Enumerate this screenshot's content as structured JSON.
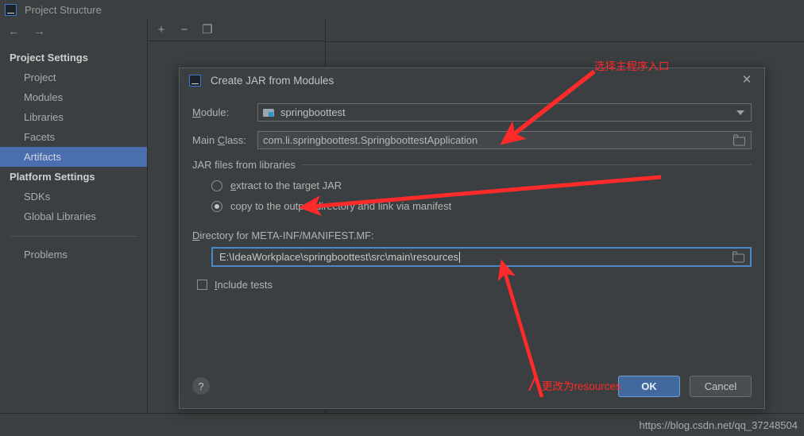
{
  "window": {
    "title": "Project Structure",
    "logo_text": "IJ",
    "nav": {
      "back": "←",
      "forward": "→"
    }
  },
  "sidebar": {
    "groups": [
      {
        "label": "Project Settings",
        "items": [
          {
            "label": "Project",
            "selected": false
          },
          {
            "label": "Modules",
            "selected": false
          },
          {
            "label": "Libraries",
            "selected": false
          },
          {
            "label": "Facets",
            "selected": false
          },
          {
            "label": "Artifacts",
            "selected": true
          }
        ]
      },
      {
        "label": "Platform Settings",
        "items": [
          {
            "label": "SDKs",
            "selected": false
          },
          {
            "label": "Global Libraries",
            "selected": false
          }
        ]
      }
    ],
    "problems_label": "Problems"
  },
  "toolbar": {
    "add_label": "+",
    "remove_label": "−",
    "copy_label": "❐"
  },
  "dialog": {
    "title": "Create JAR from Modules",
    "logo_text": "IJ",
    "close_label": "✕",
    "module": {
      "label_prefix": "M",
      "label_rest": "odule:",
      "value": "springboottest"
    },
    "main_class": {
      "label_prefix": "Main ",
      "label_underlined": "C",
      "label_rest": "lass:",
      "value": "com.li.springboottest.SpringboottestApplication"
    },
    "jar_group": {
      "title": "JAR files from libraries",
      "options": [
        {
          "label_underlined": "e",
          "label_rest": "xtract to the target JAR",
          "label_full": "extract to the target JAR",
          "selected": false
        },
        {
          "label_full": "copy to the output directory and link via manifest",
          "selected": true
        }
      ]
    },
    "directory": {
      "label_underlined": "D",
      "label_rest": "irectory for META-INF/MANIFEST.MF:",
      "value": "E:\\IdeaWorkplace\\springboottest\\src\\main\\resources"
    },
    "include_tests": {
      "label_underlined": "I",
      "label_rest": "nclude tests",
      "checked": false
    },
    "footer": {
      "help_label": "?",
      "ok_label": "OK",
      "cancel_label": "Cancel"
    }
  },
  "annotations": {
    "top": "选择主程序入口",
    "bottom": "更改为resources",
    "color": "#ff2a2a"
  },
  "watermark": "https://blog.csdn.net/qq_37248504",
  "colors": {
    "background": "#3c3f41",
    "selection": "#4b6eaf",
    "accent_focus": "#4a88c7",
    "primary_button": "#41699e"
  }
}
